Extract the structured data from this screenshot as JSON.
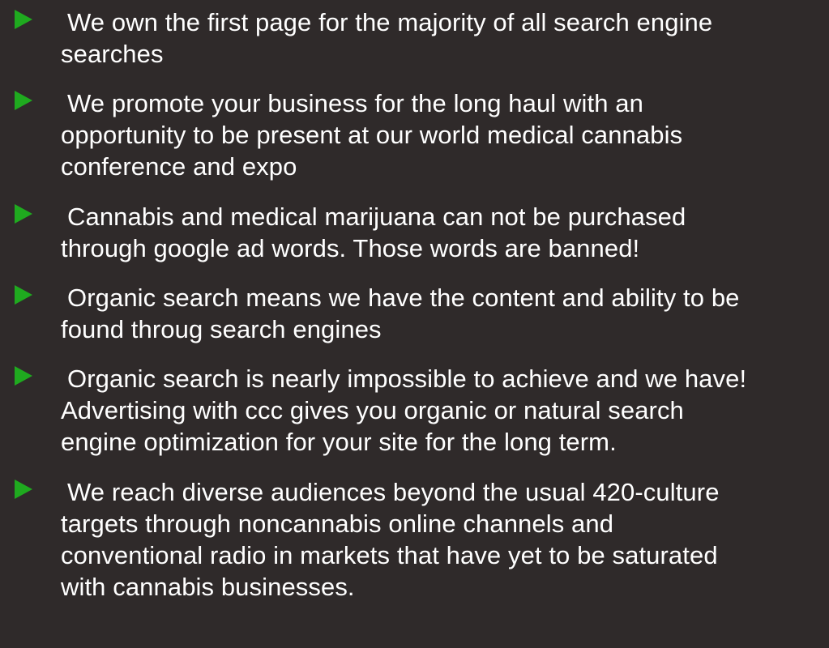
{
  "colors": {
    "background": "#2f2a2a",
    "text": "#ffffff",
    "bullet": "#1faa1f"
  },
  "icons": {
    "bullet": "triangle-bullet-icon"
  },
  "bullets": [
    {
      "lines": [
        "We own the first page for the majority of all search engine",
        "searches"
      ]
    },
    {
      "lines": [
        "We promote your business for the long haul with an",
        "opportunity to be present at our world medical cannabis",
        "conference and expo"
      ]
    },
    {
      "lines": [
        "Cannabis and medical marijuana can not be purchased",
        "through google ad words.  Those words are banned!"
      ]
    },
    {
      "lines": [
        "Organic search means we have the content and ability to be",
        "found throug search engines"
      ]
    },
    {
      "lines": [
        "Organic search is nearly impossible to achieve and we have!",
        "Advertising with ccc gives you organic or natural search",
        "engine optimization for your site for the long term."
      ]
    },
    {
      "lines": [
        "We reach diverse audiences beyond the usual 420-culture",
        "targets through noncannabis online channels and",
        "conventional radio in markets that have yet to be saturated",
        "with cannabis businesses."
      ]
    }
  ]
}
